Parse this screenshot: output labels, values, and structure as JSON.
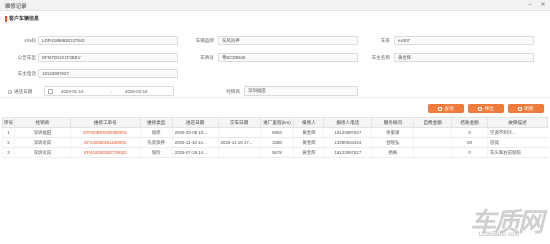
{
  "window": {
    "title": "维修记录",
    "min_icon": "minimize-icon",
    "close_icon": "close-icon"
  },
  "section": {
    "title": "客户车辆信息"
  },
  "vehicle_fields": {
    "vin_label": "VIN码",
    "vin_value": "LDP41896850137842",
    "brand_label": "车辆品牌",
    "brand_value": "东风风神",
    "series_label": "车系",
    "series_value": "ev007",
    "notice_label": "公告车型",
    "notice_value": "DFM7001S1F3BEV",
    "plate_label": "车牌号",
    "plate_value": "粤BCD9549",
    "owner_label": "车主名称",
    "owner_value": "黄金辉",
    "phone_label": "车主电话",
    "phone_value": "18123897627"
  },
  "filters": {
    "date_label": "进店日期",
    "date_from": "2023-01-14",
    "date_to": "2026-03-15",
    "shop_label": "经销商",
    "shop_value": "深圳福田"
  },
  "buttons": {
    "search": "查询",
    "export": "导出",
    "refresh": "刷新"
  },
  "table": {
    "headers": [
      "序号",
      "经销商",
      "维修工单号",
      "维修类型",
      "进店日期",
      "交车日期",
      "进厂里程(km)",
      "报修人",
      "报修人电话",
      "服务顾问",
      "自费金额",
      "结账金额",
      "故障描述"
    ],
    "rows": [
      [
        "1",
        "深圳福田",
        "EP400BR0290380001",
        "保修",
        "2025-03-08 10...",
        "",
        "6803",
        "黄金辉",
        "18123897627",
        "余俊锋",
        "",
        "0",
        "空调不制冷..."
      ],
      [
        "2",
        "深圳龙岗",
        "EF440050251180002",
        "先装保养",
        "2025-11-16 14...",
        "2025-11-16 17...",
        "3388",
        "黄金辉",
        "13380934434",
        "甘晓弘",
        "",
        "60",
        "首保"
      ],
      [
        "3",
        "深圳龙岗",
        "EP440050250729003",
        "保险",
        "2025-07-29 14...",
        "",
        "5678",
        "黄金辉",
        "18123897627",
        "杨梅",
        "",
        "0",
        "车头和右前保照"
      ]
    ]
  },
  "watermark": {
    "brand": "车质网",
    "url": "12365auto.com"
  }
}
